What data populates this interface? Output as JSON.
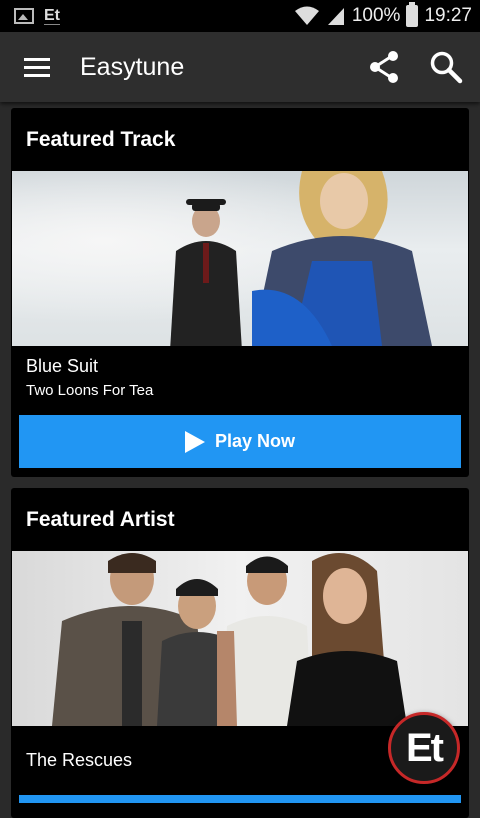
{
  "status_bar": {
    "app_badge": "Et",
    "battery_percent": "100%",
    "time": "19:27"
  },
  "app_bar": {
    "title": "Easytune",
    "menu_icon": "hamburger-menu-icon",
    "share_icon": "share-icon",
    "search_icon": "search-icon"
  },
  "featured_track": {
    "header": "Featured Track",
    "track_name": "Blue Suit",
    "artist_name": "Two Loons For Tea",
    "play_label": "Play Now"
  },
  "featured_artist": {
    "header": "Featured Artist",
    "artist_name": "The Rescues"
  },
  "fab": {
    "label": "Et",
    "accent": "#c62828"
  },
  "colors": {
    "accent_blue": "#2196f3",
    "card_bg": "#000000",
    "page_bg": "#2a2a2a"
  }
}
